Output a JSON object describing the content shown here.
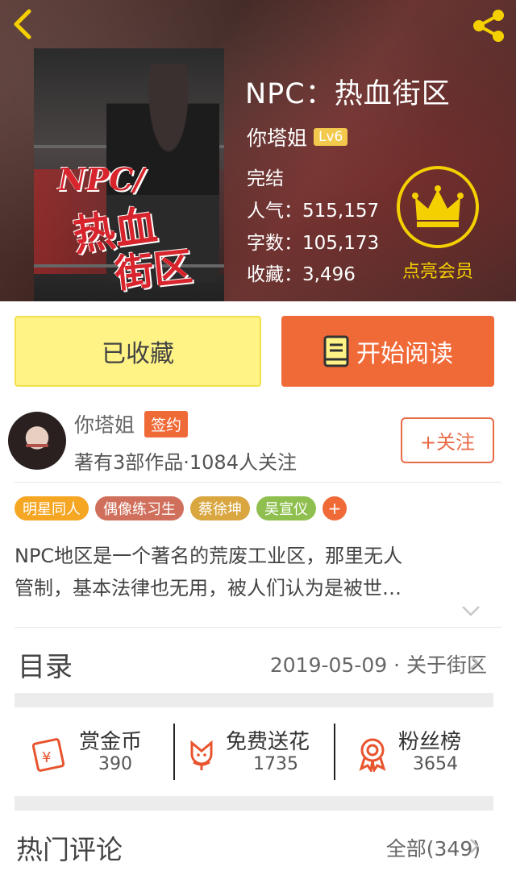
{
  "header": {
    "back_icon": "chevron-left-icon",
    "share_icon": "share-icon",
    "accent_color": "#f5d000"
  },
  "book": {
    "cover_text": [
      "NPC/",
      "热血",
      "街区"
    ],
    "title": "NPC：热血街区",
    "author": "你塔姐",
    "level": "Lv6",
    "status": "完结",
    "popularity": "人气：515,157",
    "word_count": "字数：105,173",
    "favorites": "收藏：3,496"
  },
  "vip": {
    "label": "点亮会员",
    "icon": "crown-icon"
  },
  "actions": {
    "favorite_label": "已收藏",
    "read_label": "开始阅读",
    "read_color": "#f06a38",
    "favorite_color": "#fff385"
  },
  "author_card": {
    "name": "你塔姐",
    "badge": "签约",
    "info": "著有3部作品·1084人关注",
    "follow_label": "+关注"
  },
  "tags": [
    {
      "label": "明星同人",
      "color": "#f5a623"
    },
    {
      "label": "偶像练习生",
      "color": "#d0705c"
    },
    {
      "label": "蔡徐坤",
      "color": "#d9a640"
    },
    {
      "label": "吴宣仪",
      "color": "#8fc04f"
    },
    {
      "label": "+",
      "color": "#f06a38"
    }
  ],
  "description": {
    "line1": "NPC地区是一个著名的荒废工业区，那里无人",
    "line2": "管制，基本法律也无用，被人们认为是被世…"
  },
  "toc": {
    "label": "目录",
    "latest": "2019-05-09 · 关于街区"
  },
  "stats": [
    {
      "title": "赏金币",
      "value": "390",
      "icon": "red-envelope-icon"
    },
    {
      "title": "免费送花",
      "value": "1735",
      "icon": "flower-icon"
    },
    {
      "title": "粉丝榜",
      "value": "3654",
      "icon": "award-ribbon-icon"
    }
  ],
  "comments": {
    "label": "热门评论",
    "all": "全部(349)"
  }
}
